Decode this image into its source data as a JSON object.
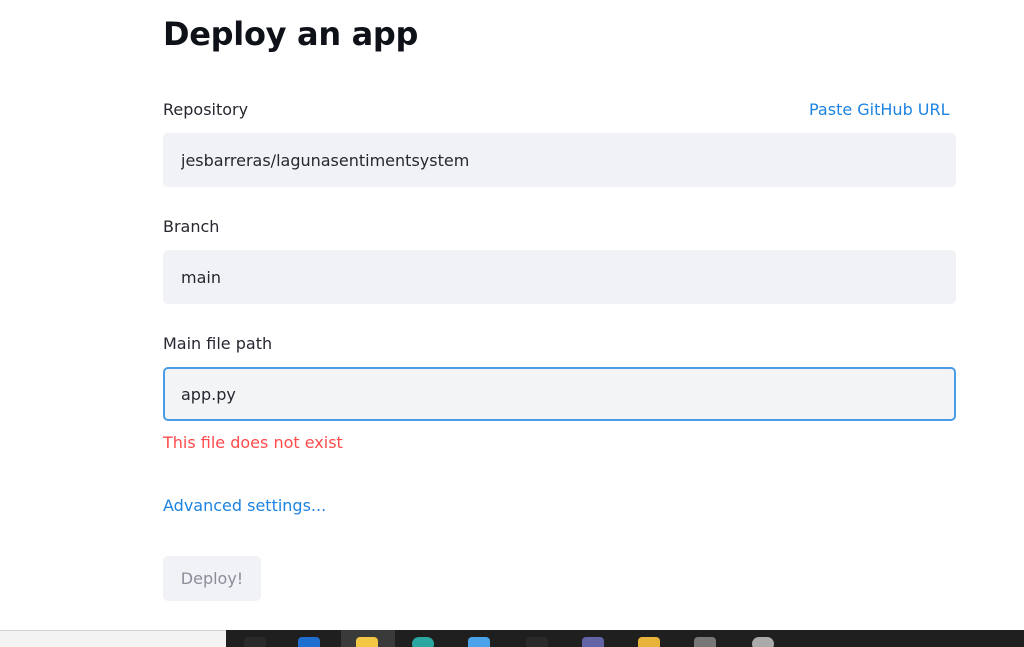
{
  "page": {
    "title": "Deploy an app"
  },
  "repository": {
    "label": "Repository",
    "paste_link": "Paste GitHub URL",
    "value": "jesbarreras/lagunasentimentsystem"
  },
  "branch": {
    "label": "Branch",
    "value": "main"
  },
  "main_file": {
    "label": "Main file path",
    "value": "app.py",
    "error": "This file does not exist"
  },
  "advanced": {
    "label": "Advanced settings..."
  },
  "deploy": {
    "label": "Deploy!"
  },
  "colors": {
    "accent": "#1c83e1",
    "error": "#ff4b4b",
    "field_bg": "#f0f2f6",
    "focus_border": "#4a9ce8"
  },
  "taskbar": {
    "icons": [
      "search-icon",
      "edge-icon",
      "file-explorer-icon",
      "chrome-icon",
      "store-icon",
      "settings-icon",
      "teams-icon",
      "folder-icon",
      "app-icon",
      "app-icon-2"
    ]
  }
}
